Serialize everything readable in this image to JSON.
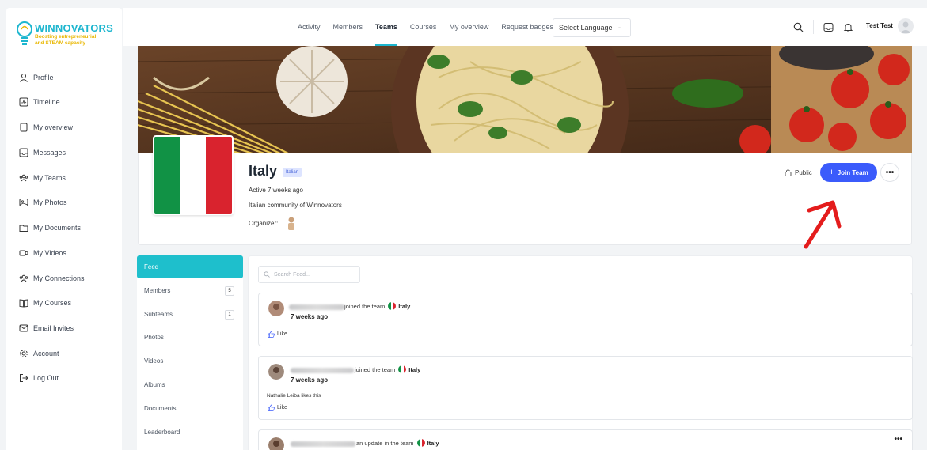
{
  "brand": {
    "title": "WINNOVATORS",
    "subtitle_line1": "Boosting entrepreneurial",
    "subtitle_line2": "and STEAM capacity",
    "accent": "#1db6cf",
    "sub_color": "#e9b700"
  },
  "sidebar": {
    "items": [
      {
        "label": "Profile",
        "icon": "user-icon"
      },
      {
        "label": "Timeline",
        "icon": "timeline-icon"
      },
      {
        "label": "My overview",
        "icon": "document-icon"
      },
      {
        "label": "Messages",
        "icon": "inbox-icon"
      },
      {
        "label": "My Teams",
        "icon": "teams-icon"
      },
      {
        "label": "My Photos",
        "icon": "photo-icon"
      },
      {
        "label": "My Documents",
        "icon": "folder-icon"
      },
      {
        "label": "My Videos",
        "icon": "video-icon"
      },
      {
        "label": "My Connections",
        "icon": "connections-icon"
      },
      {
        "label": "My Courses",
        "icon": "book-icon"
      },
      {
        "label": "Email Invites",
        "icon": "mail-icon"
      },
      {
        "label": "Account",
        "icon": "gear-icon"
      },
      {
        "label": "Log Out",
        "icon": "logout-icon"
      }
    ]
  },
  "topbar": {
    "tabs": [
      {
        "label": "Activity",
        "active": false
      },
      {
        "label": "Members",
        "active": false
      },
      {
        "label": "Teams",
        "active": true
      },
      {
        "label": "Courses",
        "active": false
      },
      {
        "label": "My overview",
        "active": false
      },
      {
        "label": "Request badges",
        "active": false
      }
    ],
    "language": "Select Language",
    "user_name": "Test Test"
  },
  "team": {
    "name": "Italy",
    "badge": "Italian",
    "active": "Active 7 weeks ago",
    "description": "Italian community of Winnovators",
    "organizer_label": "Organizer:",
    "privacy": "Public",
    "join_label": "Join Team",
    "flag_colors": [
      "#119245",
      "#ffffff",
      "#d9232e"
    ]
  },
  "subnav": {
    "items": [
      {
        "label": "Feed",
        "active": true,
        "count": ""
      },
      {
        "label": "Members",
        "active": false,
        "count": "5"
      },
      {
        "label": "Subteams",
        "active": false,
        "count": "1"
      },
      {
        "label": "Photos",
        "active": false,
        "count": ""
      },
      {
        "label": "Videos",
        "active": false,
        "count": ""
      },
      {
        "label": "Albums",
        "active": false,
        "count": ""
      },
      {
        "label": "Documents",
        "active": false,
        "count": ""
      },
      {
        "label": "Leaderboard",
        "active": false,
        "count": ""
      }
    ]
  },
  "feed": {
    "search_placeholder": "Search Feed...",
    "posts": [
      {
        "action": "joined the team",
        "team": "Italy",
        "time": "7 weeks ago",
        "likes_text": "",
        "like_label": "Like"
      },
      {
        "action": "joined the team",
        "team": "Italy",
        "time": "7 weeks ago",
        "likes_text": "Nathalie Leiba likes this",
        "like_label": "Like"
      },
      {
        "action": "an update in the team",
        "team": "Italy",
        "time": "",
        "likes_text": "",
        "like_label": ""
      }
    ]
  }
}
